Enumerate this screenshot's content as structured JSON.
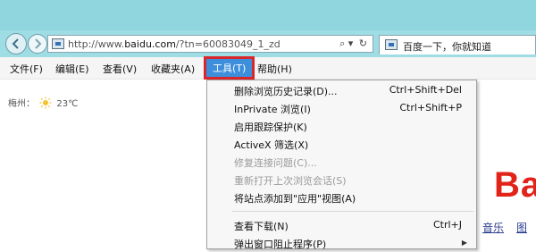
{
  "address_bar": {
    "url_prefix": "http://www.",
    "url_domain": "baidu.com",
    "url_suffix": "/?tn=60083049_1_zd",
    "search_glyph": "⌕ ▾",
    "refresh_glyph": "↻",
    "tab_title": "百度一下，你就知道"
  },
  "menu": {
    "file": "文件(F)",
    "edit": "编辑(E)",
    "view": "查看(V)",
    "favorites": "收藏夹(A)",
    "tools": "工具(T)",
    "help": "帮助(H)"
  },
  "weather": {
    "city": "梅州：",
    "temp": "23℃"
  },
  "page": {
    "logo_text": "Ba",
    "links": [
      "音乐",
      "图"
    ]
  },
  "tools_menu": {
    "items": [
      {
        "label": "删除浏览历史记录(D)...",
        "shortcut": "Ctrl+Shift+Del"
      },
      {
        "label": "InPrivate 浏览(I)",
        "shortcut": "Ctrl+Shift+P"
      },
      {
        "label": "启用跟踪保护(K)",
        "shortcut": ""
      },
      {
        "label": "ActiveX 筛选(X)",
        "shortcut": ""
      },
      {
        "label": "修复连接问题(C)...",
        "shortcut": ""
      },
      {
        "label": "重新打开上次浏览会话(S)",
        "shortcut": ""
      },
      {
        "label": "将站点添加到\"应用\"视图(A)",
        "shortcut": ""
      },
      {
        "label": "查看下载(N)",
        "shortcut": "Ctrl+J"
      },
      {
        "label": "弹出窗口阻止程序(P)",
        "shortcut": ""
      }
    ]
  },
  "colors": {
    "accent": "#3d8fdc",
    "highlight_border": "#d9262a",
    "logo_red": "#e2231a"
  }
}
